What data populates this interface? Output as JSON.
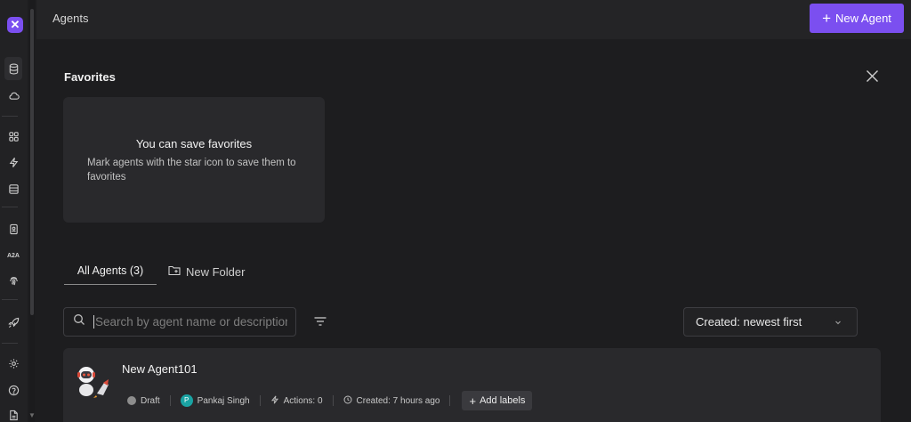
{
  "header": {
    "title": "Agents",
    "new_agent_label": "New Agent"
  },
  "sidebar": {
    "items": [
      {
        "name": "database-icon"
      },
      {
        "name": "cloud-icon"
      },
      {
        "name": "grid-icon"
      },
      {
        "name": "lightning-icon"
      },
      {
        "name": "table-icon"
      },
      {
        "name": "contact-card-icon"
      },
      {
        "label": "A2A"
      },
      {
        "name": "fingerprint-icon"
      },
      {
        "name": "rocket-icon"
      },
      {
        "name": "settings-icon"
      },
      {
        "name": "help-icon"
      },
      {
        "name": "document-icon"
      }
    ]
  },
  "favorites": {
    "title": "Favorites",
    "empty_title": "You can save favorites",
    "empty_desc": "Mark agents with the star icon to save them to favorites"
  },
  "tabs": {
    "all_agents": "All Agents (3)",
    "new_folder": "New Folder"
  },
  "search": {
    "placeholder": "Search by agent name or description"
  },
  "sort": {
    "value": "Created: newest first"
  },
  "agents": [
    {
      "name": "New Agent101",
      "status": "Draft",
      "owner_initial": "P",
      "owner": "Pankaj Singh",
      "actions": "Actions: 0",
      "created": "Created: 7 hours ago",
      "add_labels": "Add labels"
    }
  ],
  "colors": {
    "accent": "#7b4ff0",
    "background": "#1d1d1f",
    "card": "#29292c",
    "owner_avatar": "#1aa3a3"
  }
}
